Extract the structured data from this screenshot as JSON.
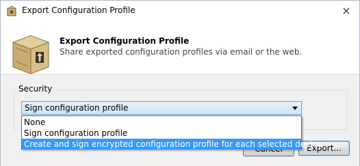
{
  "window": {
    "title": "Export Configuration Profile"
  },
  "header": {
    "title": "Export Configuration Profile",
    "subtitle": "Share exported configuration profiles via email or the web."
  },
  "security": {
    "group_label": "Security",
    "selected_option": "Sign configuration profile",
    "options": [
      "None",
      "Sign configuration profile",
      "Create and sign encrypted configuration profile for each selected device"
    ],
    "highlighted_index": 2
  },
  "buttons": {
    "cancel_label": "Cancel",
    "export_label": "Export..."
  },
  "icons": {
    "app": "configurator-icon",
    "close": "close-icon",
    "header": "package-box-icon",
    "dropdown": "chevron-down-icon"
  }
}
